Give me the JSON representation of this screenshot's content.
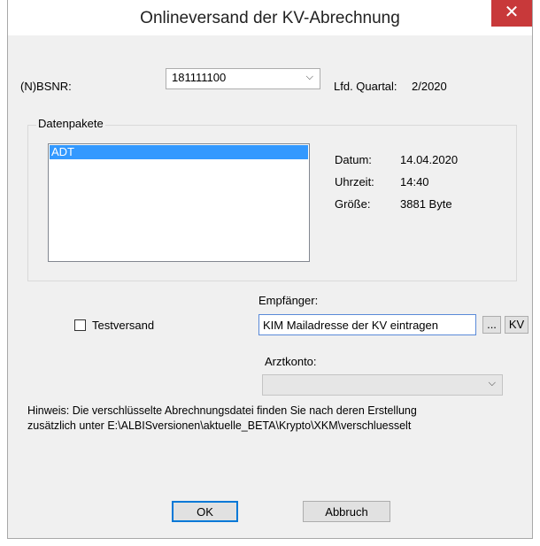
{
  "window": {
    "title": "Onlineversand der KV-Abrechnung",
    "close_label": "✕"
  },
  "bsnr": {
    "label": "(N)BSNR:",
    "value": "181111100",
    "arrow": "⌵"
  },
  "quartal": {
    "label": "Lfd. Quartal:",
    "value": "2/2020"
  },
  "datenpakete": {
    "title": "Datenpakete",
    "items": [
      "ADT"
    ],
    "selected_index": 0,
    "datum_label": "Datum:",
    "datum_value": "14.04.2020",
    "uhrzeit_label": "Uhrzeit:",
    "uhrzeit_value": "14:40",
    "groesse_label": "Größe:",
    "groesse_value": "3881 Byte"
  },
  "empfaenger": {
    "label": "Empfänger:",
    "value": "KIM Mailadresse der KV eintragen",
    "browse_label": "...",
    "kv_label": "KV"
  },
  "testversand": {
    "label": "Testversand",
    "checked": false
  },
  "arztkonto": {
    "label": "Arztkonto:",
    "value": "",
    "arrow": "⌵",
    "enabled": false
  },
  "hint": {
    "line1": "Hinweis: Die verschlüsselte Abrechnungsdatei finden Sie nach deren Erstellung",
    "line2": "zusätzlich unter E:\\ALBISversionen\\aktuelle_BETA\\Krypto\\XKM\\verschluesselt"
  },
  "buttons": {
    "ok_label": "OK",
    "cancel_label": "Abbruch"
  }
}
